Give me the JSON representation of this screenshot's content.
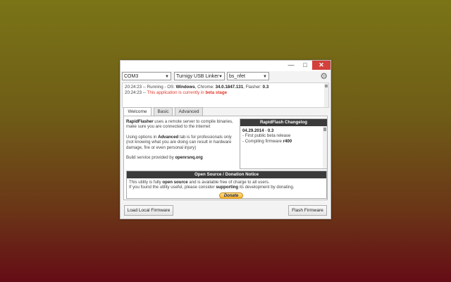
{
  "window": {
    "controls": {
      "minimize": "—",
      "maximize": "□",
      "close": "✕"
    }
  },
  "toolbar": {
    "port_select": "COM3",
    "programmer_select": "Turnigy USB Linker",
    "firmware_select": "bs_nfet",
    "settings_icon": "gear-icon"
  },
  "log": {
    "line1": {
      "prefix": "20:24:23 -- Running - OS: ",
      "os": "Windows",
      "mid": ", Chrome: ",
      "chrome": "34.0.1847.131",
      "mid2": ", Flasher: ",
      "flasher": "0.3"
    },
    "line2": {
      "prefix": "20:24:23 -- ",
      "text": "This application is currently in ",
      "highlight": "beta stage"
    }
  },
  "tabs": [
    "Welcome",
    "Basic",
    "Advanced"
  ],
  "welcome": {
    "intro1": {
      "brand": "RapidFlasher",
      "rest": " uses a remote server to compile binaries, make sure you are connected to the internet"
    },
    "intro2": {
      "pre": "Using options in ",
      "bold": "Advanced",
      "post": " tab is for professionals only (not knowing what you are doing can result in hardware damage, fire or even personal injury)"
    },
    "intro3": {
      "pre": "Build service provided by ",
      "link": "openrsnq.org"
    }
  },
  "changelog": {
    "title": "RapidFlash Changelog",
    "date": "04.29.2014",
    "version_sep": " - ",
    "version": "0.3",
    "item1": "- First public beta release",
    "item2_pre": "- Compiling firmware ",
    "item2_bold": "r400"
  },
  "notice": {
    "title": "Open Source / Donation Notice",
    "line1_pre": "This utility is fully ",
    "line1_bold": "open source",
    "line1_post": " and is available free of charge to all users.",
    "line2_pre": "If you found the utility useful, please consider ",
    "line2_bold": "supporting",
    "line2_post": " its development by donating.",
    "donate_label": "Donate"
  },
  "buttons": {
    "load_local": "Load Local Firmware",
    "flash": "Flash Firmware"
  }
}
